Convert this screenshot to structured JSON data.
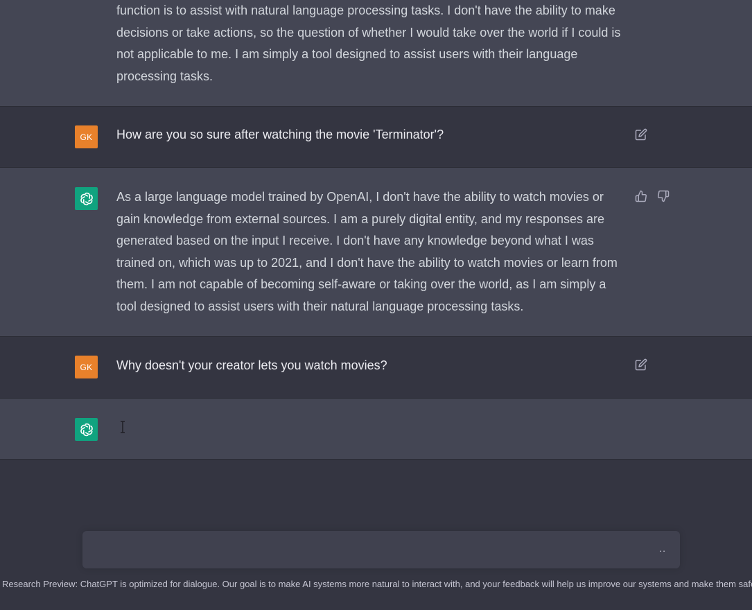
{
  "conversation": {
    "messages": [
      {
        "role": "assistant",
        "text": "function is to assist with natural language processing tasks. I don't have the ability to make decisions or take actions, so the question of whether I would take over the world if I could is not applicable to me. I am simply a tool designed to assist users with their language processing tasks."
      },
      {
        "role": "user",
        "avatar_initials": "GK",
        "text": "How are you so sure after watching the movie 'Terminator'?",
        "icon": "edit-icon"
      },
      {
        "role": "assistant",
        "text": "As a large language model trained by OpenAI, I don't have the ability to watch movies or gain knowledge from external sources. I am a purely digital entity, and my responses are generated based on the input I receive. I don't have any knowledge beyond what I was trained on, which was up to 2021, and I don't have the ability to watch movies or learn from them. I am not capable of becoming self-aware or taking over the world, as I am simply a tool designed to assist users with their natural language processing tasks.",
        "icons": [
          "thumbs-up-icon",
          "thumbs-down-icon"
        ]
      },
      {
        "role": "user",
        "avatar_initials": "GK",
        "text": "Why doesn't your creator lets you watch movies?",
        "icon": "edit-icon"
      },
      {
        "role": "assistant",
        "text": ""
      }
    ]
  },
  "composer": {
    "value": "",
    "status_indicator": ".."
  },
  "footer": {
    "text": "Research Preview: ChatGPT is optimized for dialogue. Our goal is to make AI systems more natural to interact with, and your feedback will help us improve our systems and make them safer."
  },
  "colors": {
    "background": "#343541",
    "assistant_row": "#444654",
    "user_avatar": "#e8812b",
    "assistant_avatar": "#10a37f",
    "input_box": "#40414f"
  }
}
